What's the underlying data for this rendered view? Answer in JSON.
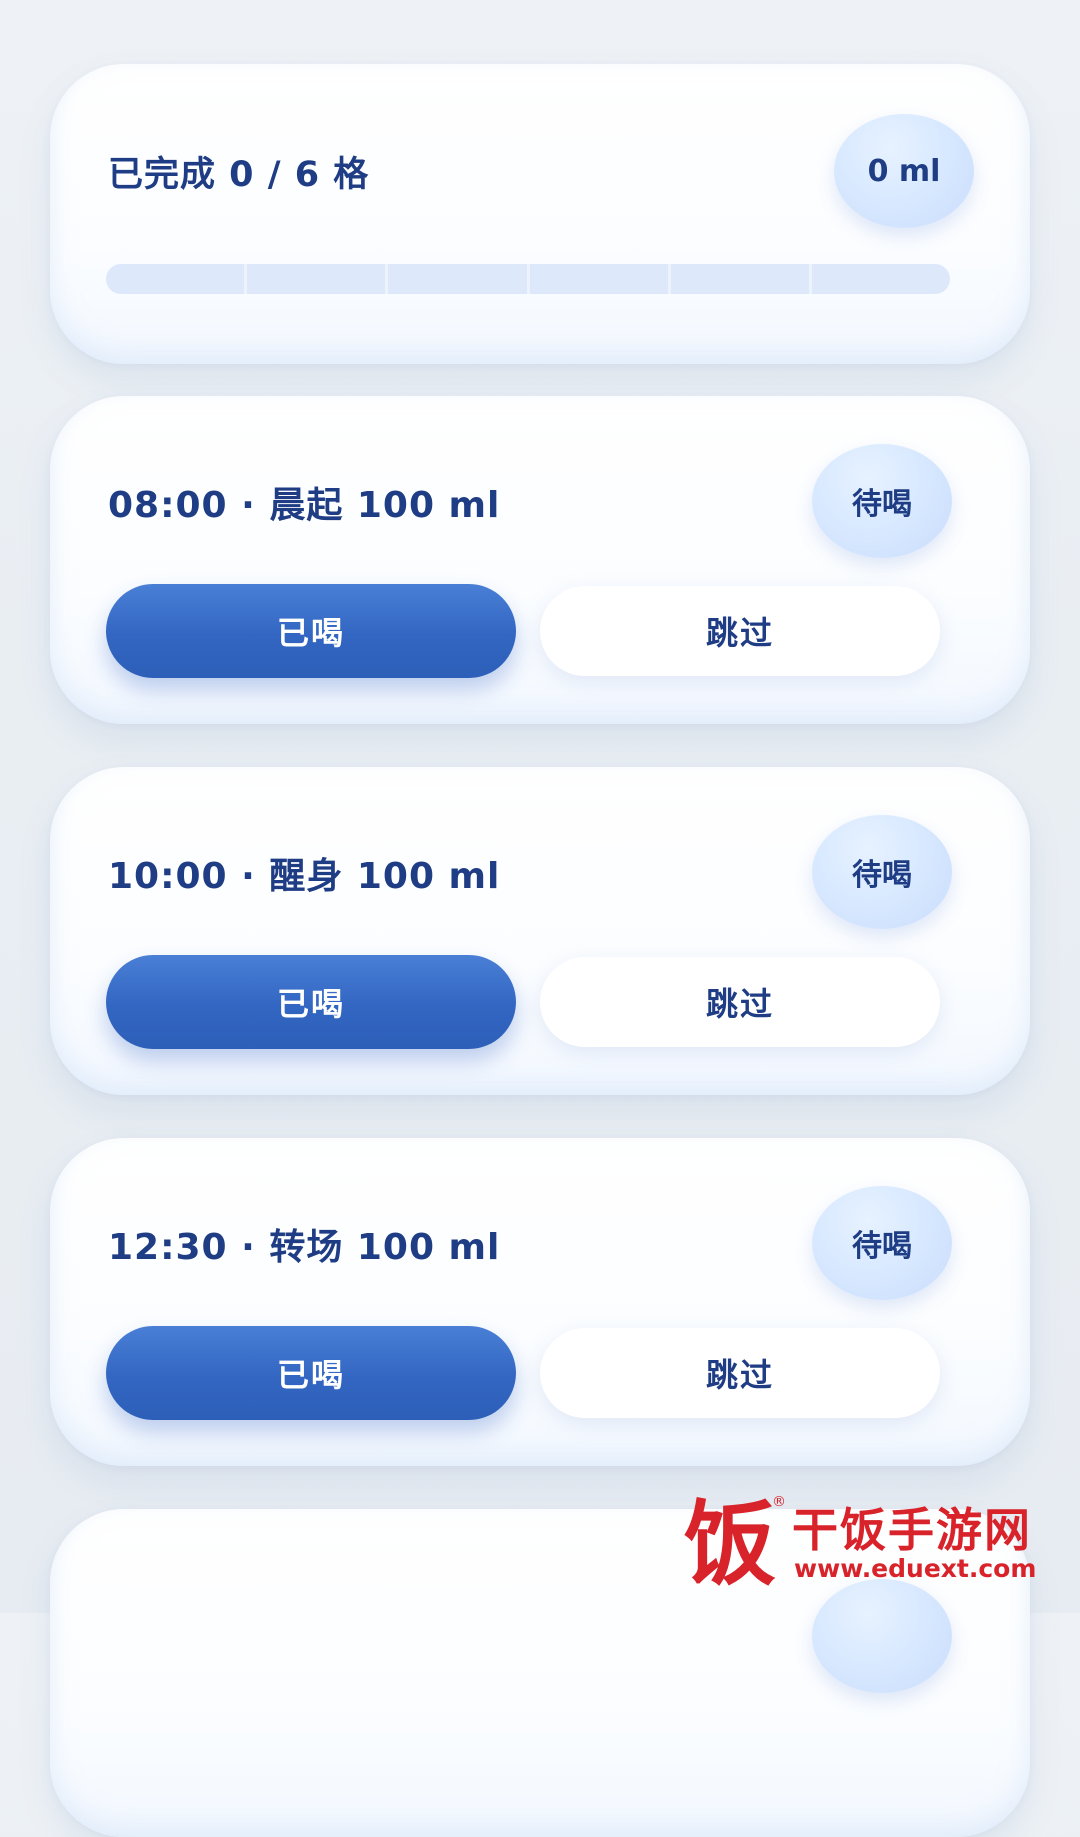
{
  "summary": {
    "title": "已完成 0 / 6 格",
    "total_badge": "0 ml",
    "progress": {
      "completed": 0,
      "total": 6
    }
  },
  "entries": [
    {
      "title": "08:00 · 晨起 100 ml",
      "status": "待喝",
      "drank_label": "已喝",
      "skip_label": "跳过"
    },
    {
      "title": "10:00 · 醒身 100 ml",
      "status": "待喝",
      "drank_label": "已喝",
      "skip_label": "跳过"
    },
    {
      "title": "12:30 · 转场 100 ml",
      "status": "待喝",
      "drank_label": "已喝",
      "skip_label": "跳过"
    }
  ],
  "watermark": {
    "glyph": "饭",
    "registered_mark": "®",
    "name": "干饭手游网",
    "url": "www.eduext.com"
  },
  "colors": {
    "accent": "#3469c6",
    "text": "#1f3d84",
    "badge": "#d7e8ff",
    "watermark": "#d8232a"
  }
}
